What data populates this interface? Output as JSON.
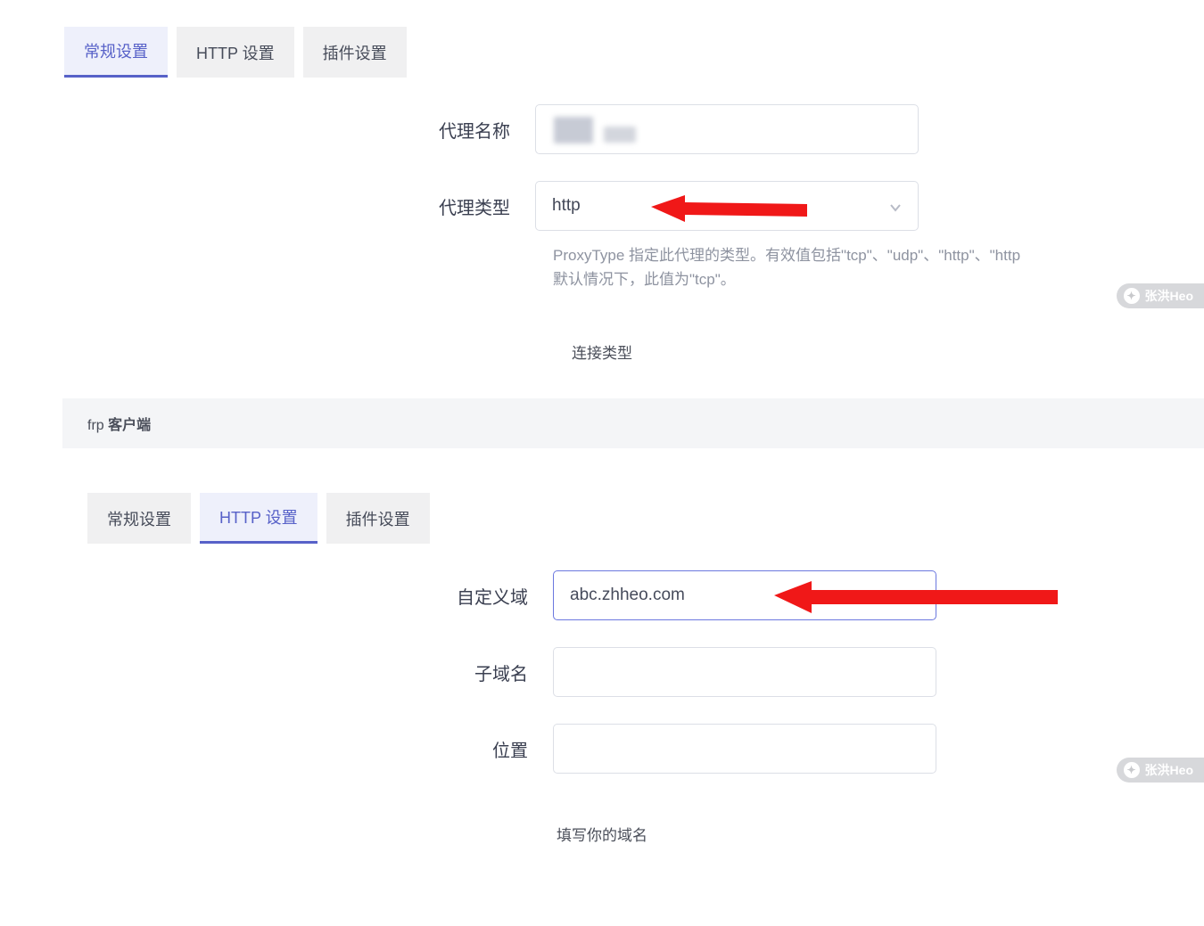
{
  "watermark": "张洪Heo",
  "section1": {
    "tabs": [
      "常规设置",
      "HTTP 设置",
      "插件设置"
    ],
    "active_tab_index": 0,
    "fields": {
      "proxy_name_label": "代理名称",
      "proxy_type_label": "代理类型",
      "proxy_type_value": "http",
      "proxy_type_hint_line1": "ProxyType 指定此代理的类型。有效值包括\"tcp\"、\"udp\"、\"http\"、\"http",
      "proxy_type_hint_line2": "默认情况下，此值为\"tcp\"。"
    },
    "caption": "连接类型"
  },
  "section2": {
    "panel_title_prefix": "frp ",
    "panel_title_bold": "客户端",
    "tabs": [
      "常规设置",
      "HTTP 设置",
      "插件设置"
    ],
    "active_tab_index": 1,
    "fields": {
      "custom_domain_label": "自定义域",
      "custom_domain_value": "abc.zhheo.com",
      "subdomain_label": "子域名",
      "subdomain_value": "",
      "location_label": "位置",
      "location_value": ""
    },
    "caption": "填写你的域名"
  }
}
